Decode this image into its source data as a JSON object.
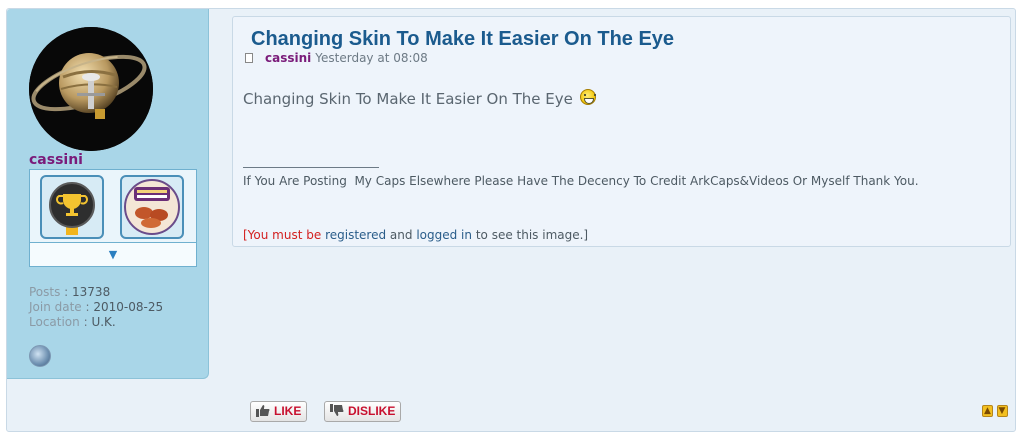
{
  "colors": {
    "accent": "#1b5b8e",
    "username": "#7a1b7a",
    "warning": "#d32020",
    "link": "#2a5d8a",
    "vote": "#c8102e"
  },
  "author": {
    "username": "cassini",
    "avatar_icon": "saturn-cassini-avatar",
    "awards": [
      {
        "icon": "trophy-award-icon"
      },
      {
        "icon": "pork-sausages-award-icon"
      }
    ],
    "awards_toggle": "▼",
    "stats": [
      {
        "label": "Posts",
        "sep": " : ",
        "value": "13738"
      },
      {
        "label": "Join date",
        "sep": " : ",
        "value": "2010-08-25"
      },
      {
        "label": "Location",
        "sep": " : ",
        "value": "U.K."
      }
    ],
    "website_icon": "globe-icon"
  },
  "post": {
    "title": "Changing Skin To Make It Easier On The Eye",
    "author": "cassini",
    "time": "Yesterday at 08:08",
    "body": "Changing Skin To Make It Easier On The Eye",
    "body_icon": "laughing-smiley-icon",
    "signature": "If You Are Posting  My Caps Elsewhere Please Have The Decency To Credit ArkCaps&Videos Or Myself Thank You.",
    "notice": {
      "open": "[You must be",
      "link1": "registered",
      "and": "and",
      "link2": "logged in",
      "close": "to see this image.]"
    }
  },
  "actions": {
    "like": "LIKE",
    "dislike": "DISLIKE",
    "up_icon": "arrow-up-icon",
    "down_icon": "arrow-down-icon"
  }
}
